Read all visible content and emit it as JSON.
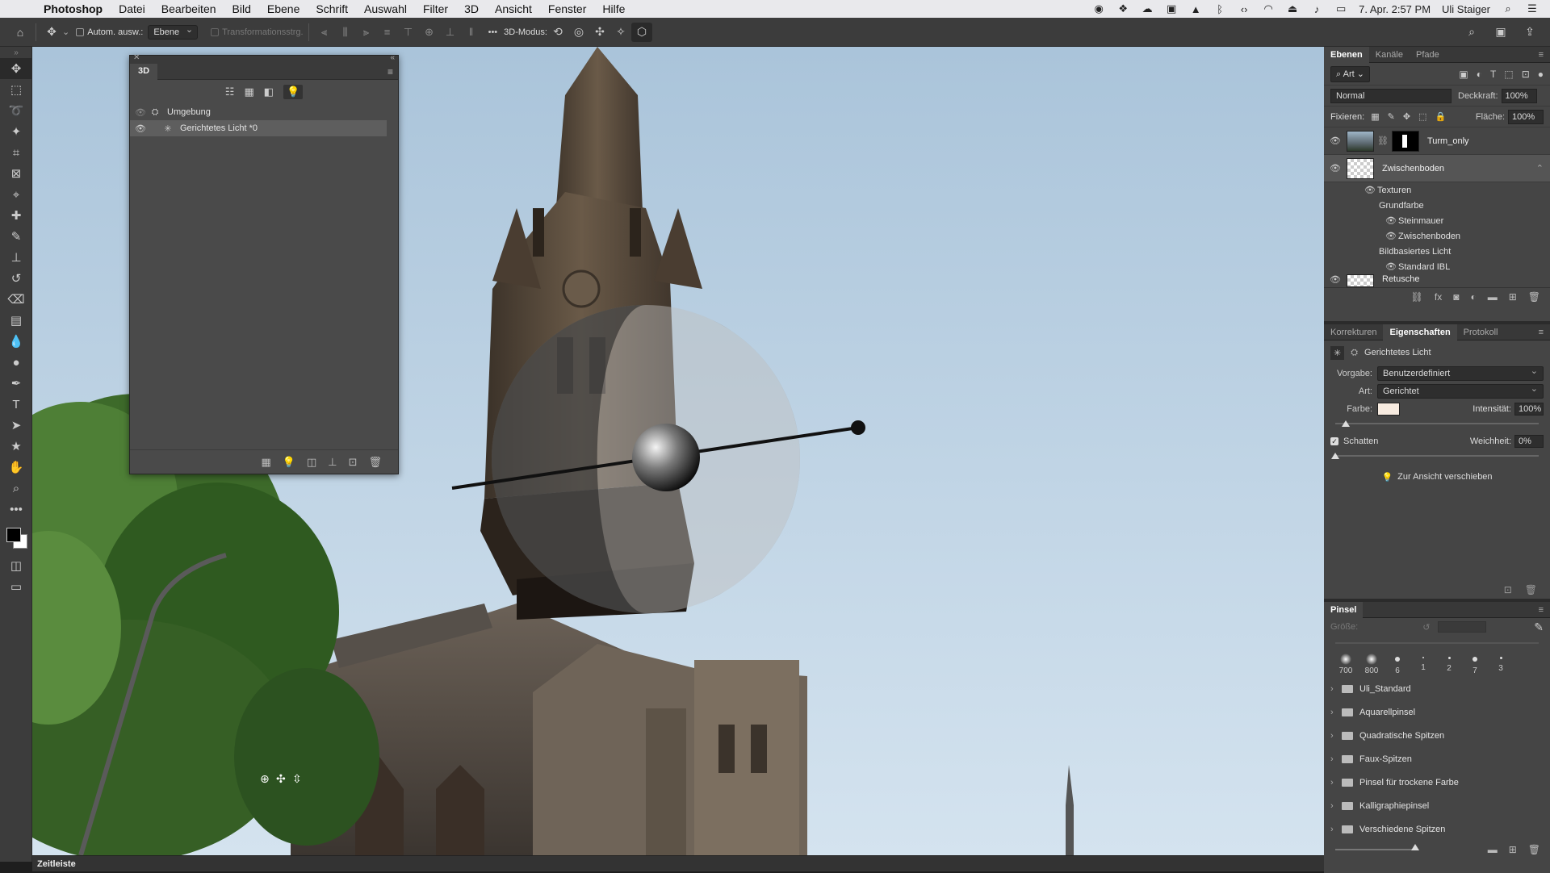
{
  "menubar": {
    "app_name": "Photoshop",
    "items": [
      "Datei",
      "Bearbeiten",
      "Bild",
      "Ebene",
      "Schrift",
      "Auswahl",
      "Filter",
      "3D",
      "Ansicht",
      "Fenster",
      "Hilfe"
    ],
    "datetime": "7. Apr.  2:57 PM",
    "user": "Uli Staiger"
  },
  "options": {
    "auto_select_label": "Autom. ausw.:",
    "auto_select_value": "Ebene",
    "transform_label": "Transformationsstrg.",
    "more": "•••",
    "mode_label": "3D-Modus:"
  },
  "panel3d": {
    "title": "3D",
    "items": [
      {
        "label": "Umgebung"
      },
      {
        "label": "Gerichtetes Licht *0"
      }
    ]
  },
  "layers_panel": {
    "tabs": [
      "Ebenen",
      "Kanäle",
      "Pfade"
    ],
    "filter_label": "Art",
    "blend_mode": "Normal",
    "opacity_label": "Deckkraft:",
    "opacity_value": "100%",
    "lock_label": "Fixieren:",
    "fill_label": "Fläche:",
    "fill_value": "100%",
    "layers": [
      {
        "name": "Turm_only"
      },
      {
        "name": "Zwischenboden"
      }
    ],
    "sublayers": {
      "textures": "Texturen",
      "base_color": "Grundfarbe",
      "stone": "Steinmauer",
      "floor": "Zwischenboden",
      "ibl": "Bildbasiertes Licht",
      "std_ibl": "Standard IBL"
    },
    "partial_layer": "Retusche"
  },
  "properties_panel": {
    "tabs": [
      "Korrekturen",
      "Eigenschaften",
      "Protokoll"
    ],
    "object_name": "Gerichtetes Licht",
    "preset_label": "Vorgabe:",
    "preset_value": "Benutzerdefiniert",
    "type_label": "Art:",
    "type_value": "Gerichtet",
    "color_label": "Farbe:",
    "color": "#f7ebe0",
    "intensity_label": "Intensität:",
    "intensity_value": "100%",
    "intensity_level": 0.05,
    "shadow_label": "Schatten",
    "softness_label": "Weichheit:",
    "softness_value": "0%",
    "move_to_view": "Zur Ansicht verschieben"
  },
  "brush_panel": {
    "title": "Pinsel",
    "size_label": "Größe:",
    "presets": [
      "700",
      "800",
      "6",
      "1",
      "2",
      "7",
      "3"
    ],
    "folders": [
      "Uli_Standard",
      "Aquarellpinsel",
      "Quadratische Spitzen",
      "Faux-Spitzen",
      "Pinsel für trockene Farbe",
      "Kalligraphiepinsel",
      "Verschiedene Spitzen"
    ]
  },
  "statusbar": {
    "label": "Zeitleiste"
  }
}
